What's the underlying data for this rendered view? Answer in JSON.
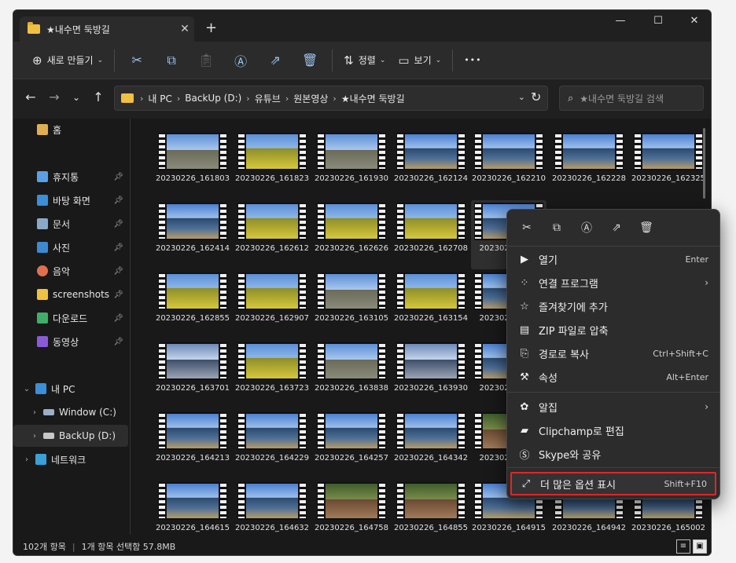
{
  "tab": {
    "title": "★내수면 둑방길",
    "close": "✕",
    "new_tab": "+"
  },
  "window_controls": {
    "minimize": "—",
    "maximize": "☐",
    "close": "✕"
  },
  "commandbar": {
    "new_label": "새로 만들기",
    "sort_label": "정렬",
    "view_label": "보기",
    "more": "•••"
  },
  "address": {
    "crumbs": [
      "내 PC",
      "BackUp (D:)",
      "유튜브",
      "원본영상",
      "★내수면 둑방길"
    ],
    "separator": "›"
  },
  "search": {
    "placeholder": "★내수면 둑방길 검색"
  },
  "sidebar": {
    "home": "홈",
    "quick": [
      {
        "label": "휴지통",
        "color": "#5aa0e6"
      },
      {
        "label": "바탕 화면",
        "color": "#3a8fd8"
      },
      {
        "label": "문서",
        "color": "#8aa8c8"
      },
      {
        "label": "사진",
        "color": "#3c8ad0"
      },
      {
        "label": "음악",
        "color": "#e07050"
      },
      {
        "label": "screenshots",
        "color": "#f0c040"
      },
      {
        "label": "다운로드",
        "color": "#3fae6a"
      },
      {
        "label": "동영상",
        "color": "#8a5ad8"
      }
    ],
    "pc": "내 PC",
    "drives": [
      "Window (C:)",
      "BackUp (D:)"
    ],
    "network": "네트워크"
  },
  "files": [
    [
      "20230226_161803",
      "20230226_161823",
      "20230226_161930",
      "20230226_162124",
      "20230226_162210",
      "20230226_162228",
      "20230226_162325"
    ],
    [
      "20230226_162414",
      "20230226_162612",
      "20230226_162626",
      "20230226_162708",
      "20230226_164"
    ],
    [
      "20230226_162855",
      "20230226_162907",
      "20230226_163105",
      "20230226_163154",
      "20230226_163"
    ],
    [
      "20230226_163701",
      "20230226_163723",
      "20230226_163838",
      "20230226_163930",
      "20230226_165"
    ],
    [
      "20230226_164213",
      "20230226_164229",
      "20230226_164257",
      "20230226_164342",
      "20230226_162"
    ],
    [
      "20230226_164615",
      "20230226_164632",
      "20230226_164758",
      "20230226_164855",
      "20230226_164915",
      "20230226_164942",
      "20230226_165002"
    ]
  ],
  "context_menu": {
    "items": [
      {
        "label": "열기",
        "shortcut": "Enter",
        "icon": "play-icon"
      },
      {
        "label": "연결 프로그램",
        "shortcut": "",
        "icon": "apps-icon",
        "submenu": true
      },
      {
        "label": "즐겨찾기에 추가",
        "shortcut": "",
        "icon": "star-icon"
      },
      {
        "label": "ZIP 파일로 압축",
        "shortcut": "",
        "icon": "zip-icon"
      },
      {
        "label": "경로로 복사",
        "shortcut": "Ctrl+Shift+C",
        "icon": "path-icon"
      },
      {
        "label": "속성",
        "shortcut": "Alt+Enter",
        "icon": "wrench-icon"
      },
      {
        "label": "알집",
        "shortcut": "",
        "icon": "alzip-icon",
        "submenu": true
      },
      {
        "label": "Clipchamp로 편집",
        "shortcut": "",
        "icon": "clipchamp-icon"
      },
      {
        "label": "Skype와 공유",
        "shortcut": "",
        "icon": "skype-icon"
      },
      {
        "label": "더 많은 옵션 표시",
        "shortcut": "Shift+F10",
        "icon": "more-options-icon"
      }
    ],
    "submenu_arrow": "›"
  },
  "status": {
    "count": "102개 항목",
    "selection": "1개 항목 선택함 57.8MB"
  },
  "colors": {
    "highlight": "#e0262a",
    "folder": "#f0c040",
    "background": "#191919"
  }
}
